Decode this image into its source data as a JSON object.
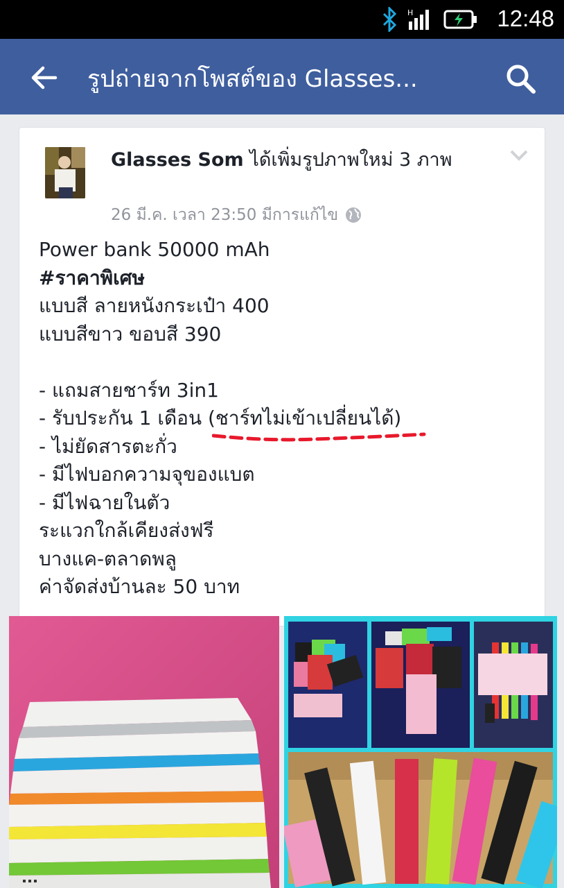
{
  "status_bar": {
    "time": "12:48"
  },
  "app_bar": {
    "title": "รูปถ่ายจากโพสต์ของ Glasses..."
  },
  "post": {
    "author": "Glasses Som",
    "action": " ได้เพิ่มรูปภาพใหม่ 3 ภาพ",
    "meta": "26 มี.ค. เวลา 23:50 มีการแก้ไข",
    "lines": [
      "Power bank 50000 mAh",
      "#ราคาพิเศษ",
      "แบบสี ลายหนังกระเป๋า 400",
      "แบบสีขาว ขอบสี 390",
      "",
      "- แถมสายชาร์ท 3in1",
      "- รับประกัน 1 เดือน (ชาร์ทไม่เข้าเปลี่ยนได้)",
      "- ไม่ยัดสารตะกั่ว",
      "- มีไฟบอกความจุของแบต",
      "- มีไฟฉายในตัว",
      "ระแวกใกล้เคียงส่งฟรี",
      "บางแค-ตลาดพลู",
      "ค่าจัดส่งบ้านละ 50 บาท"
    ]
  },
  "colors": {
    "app_bar": "#3f5e9e",
    "status_bar": "#000000",
    "accent_dash": "#e8192c",
    "photo_right_border": "#30d3e2"
  },
  "icons": [
    "bluetooth-icon",
    "signal-icon",
    "battery-icon",
    "back-arrow-icon",
    "search-icon",
    "chevron-down-icon",
    "globe-icon"
  ]
}
